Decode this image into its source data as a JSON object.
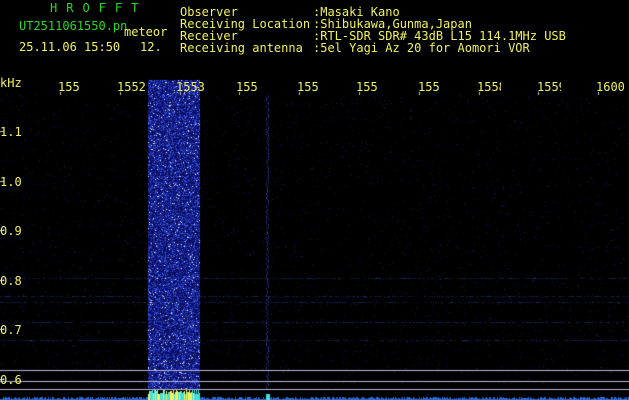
{
  "header": {
    "app_title": "HROFFT",
    "filename": "UT2511061550.pn",
    "mode": "meteor",
    "datetime": "25.11.06 15:50",
    "count": "12.",
    "info": [
      {
        "label": "Observer",
        "value": ":Masaki Kano"
      },
      {
        "label": "Receiving Location",
        "value": ":Shibukawa,Gunma,Japan"
      },
      {
        "label": "Receiver",
        "value": ":RTL-SDR SDR# 43dB L15 114.1MHz USB"
      },
      {
        "label": "Receiving antenna",
        "value": ":5el Yagi Az 20 for Aomori VOR"
      }
    ]
  },
  "axis": {
    "unit": "kHz",
    "x_ticks": [
      "155",
      "1552",
      "1553",
      "155",
      "155",
      "155(",
      "155",
      "1558",
      "1559",
      "1600"
    ],
    "y_ticks": [
      "1.1",
      "1.0",
      "0.9",
      "0.8",
      "0.7",
      "0.6"
    ]
  },
  "colors": {
    "text_green": "#26d826",
    "text_yellow": "#f2f25a",
    "background": "#000000",
    "signal": "#2a40d8"
  }
}
